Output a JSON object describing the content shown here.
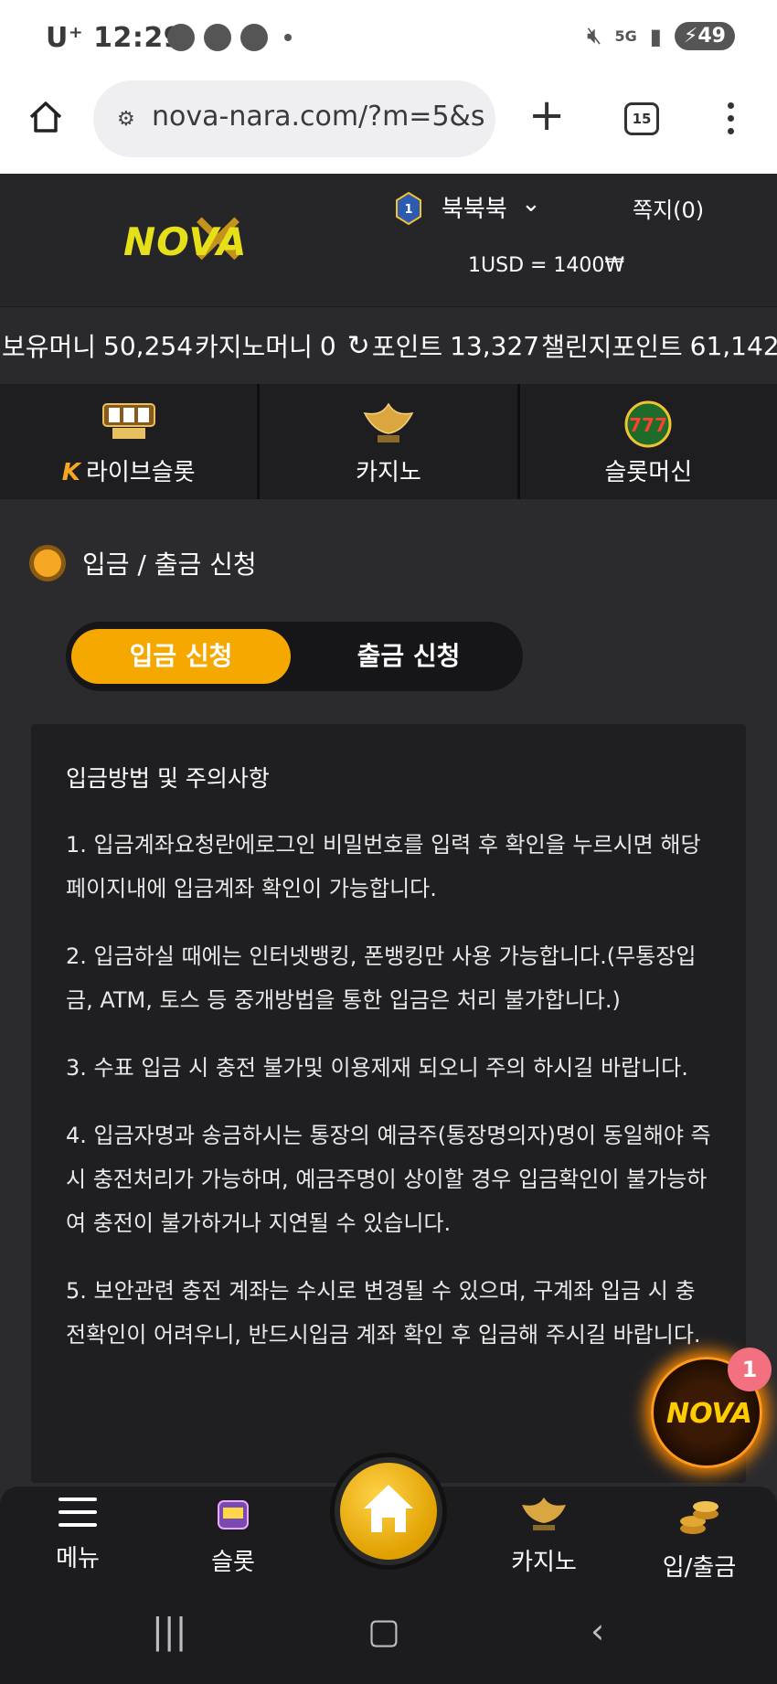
{
  "status_bar": {
    "carrier": "U⁺",
    "time": "12:29",
    "network": "5G",
    "battery": "49"
  },
  "browser": {
    "url": "nova-nara.com/?m=5&s",
    "tab_count": "15"
  },
  "header": {
    "logo_text": "NOVA",
    "username": "북북북",
    "messages": "쪽지(0)",
    "exchange_rate": "1USD = 1400₩"
  },
  "balance": {
    "money_label": "보유머니",
    "money_value": "50,254",
    "casino_label": "카지노머니",
    "casino_value": "0",
    "point_label": "포인트",
    "point_value": "13,327",
    "challenge_label": "챌린지포인트",
    "challenge_value": "61,142"
  },
  "categories": [
    {
      "label": "라이브슬롯",
      "icon": "live-slot-icon"
    },
    {
      "label": "카지노",
      "icon": "k-slot-icon"
    },
    {
      "label": "슬롯머신",
      "icon": "777-slots-icon"
    }
  ],
  "section": {
    "title": "입금 / 출금 신청"
  },
  "toggle": {
    "deposit": "입금 신청",
    "withdraw": "출금 신청",
    "active": "deposit"
  },
  "notice": {
    "title": "입금방법 및 주의사항",
    "items": [
      "1. 입금계좌요청란에로그인 비밀번호를 입력 후 확인을 누르시면 해당 페이지내에 입금계좌 확인이 가능합니다.",
      "2. 입금하실 때에는 인터넷뱅킹, 폰뱅킹만 사용 가능합니다.(무통장입금, ATM, 토스 등 중개방법을 통한 입금은 처리 불가합니다.)",
      "3. 수표 입금 시 충전 불가및 이용제재 되오니 주의 하시길 바랍니다.",
      "4. 입금자명과 송금하시는 통장의 예금주(통장명의자)명이 동일해야 즉시 충전처리가 가능하며, 예금주명이 상이할 경우 입금확인이 불가능하여 충전이 불가하거나 지연될 수 있습니다.",
      "5. 보안관련 충전 계좌는 수시로 변경될 수 있으며, 구계좌 입금 시 충전확인이 어려우니, 반드시입금 계좌 확인 후 입금해 주시길 바랍니다."
    ]
  },
  "floating": {
    "label": "NOVA",
    "badge": "1"
  },
  "bottom_nav": [
    {
      "label": "메뉴"
    },
    {
      "label": "슬롯"
    },
    {
      "label": "카지노"
    },
    {
      "label": "입/출금"
    }
  ],
  "colors": {
    "accent": "#f5a800",
    "background": "#2b2b2e",
    "panel": "#1f1f22"
  }
}
